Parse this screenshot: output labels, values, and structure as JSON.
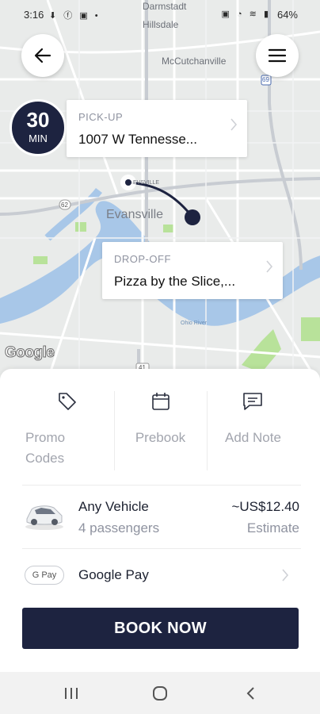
{
  "status_bar": {
    "time": "3:16",
    "left_icons": "⬇ ⓕ ▣ •",
    "right_icons": "▣ ◔ ≋ ▮",
    "battery": "64%"
  },
  "map": {
    "labels": [
      "Darmstadt",
      "Hillsdale",
      "McCutchanville",
      "Evansville",
      "Ohio River",
      "EVSVILLE"
    ],
    "route_shields": [
      "69",
      "62",
      "41"
    ],
    "attribution": "Google"
  },
  "eta": {
    "value": "30",
    "unit": "MIN"
  },
  "pickup": {
    "label": "PICK-UP",
    "address": "1007 W Tennesse..."
  },
  "dropoff": {
    "label": "DROP-OFF",
    "address": "Pizza by the Slice,..."
  },
  "options": {
    "promo": "Promo Codes",
    "prebook": "Prebook",
    "note": "Add Note"
  },
  "vehicle": {
    "name": "Any Vehicle",
    "capacity": "4 passengers",
    "price": "~US$12.40",
    "price_note": "Estimate"
  },
  "payment": {
    "badge": "G Pay",
    "method": "Google Pay"
  },
  "book_button": "BOOK NOW",
  "colors": {
    "navy": "#1d2340",
    "muted": "#8f93a0",
    "water": "#a8c7e8",
    "park": "#b8e29a"
  }
}
